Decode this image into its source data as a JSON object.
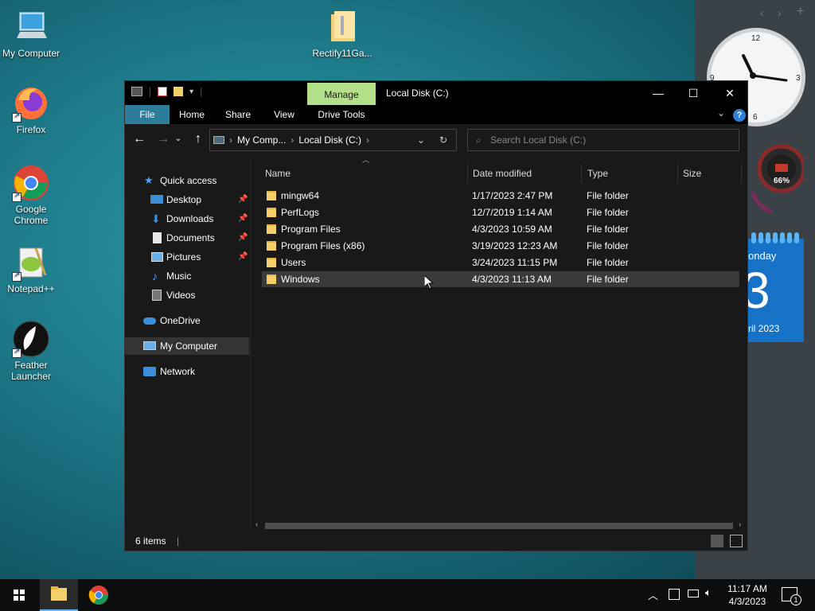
{
  "desktop": {
    "icons": [
      {
        "label": "My Computer",
        "icon": "computer-icon"
      },
      {
        "label": "Firefox",
        "icon": "firefox-icon"
      },
      {
        "label": "Google Chrome",
        "icon": "chrome-icon"
      },
      {
        "label": "Notepad++",
        "icon": "notepadpp-icon"
      },
      {
        "label": "Feather Launcher",
        "icon": "feather-icon"
      },
      {
        "label": "Rectify11Ga...",
        "icon": "zip-folder-icon"
      }
    ]
  },
  "widgets": {
    "clock": {
      "numbers": [
        "12",
        "3",
        "6",
        "9"
      ]
    },
    "gauge": {
      "value": "66%"
    },
    "calendar": {
      "day_name": "onday",
      "day": "3",
      "month_year": "ril 2023"
    }
  },
  "window": {
    "title": "Local Disk (C:)",
    "manage_tab": "Manage",
    "ribbon_tabs": [
      "File",
      "Home",
      "Share",
      "View"
    ],
    "drive_tools": "Drive Tools",
    "help": "?",
    "breadcrumb": [
      "My Comp...",
      "Local Disk (C:)"
    ],
    "search_placeholder": "Search Local Disk (C:)",
    "nav_pane": [
      {
        "label": "Quick access",
        "icon": "star-icon",
        "pinned": false
      },
      {
        "label": "Desktop",
        "icon": "desktop-icon",
        "pinned": true
      },
      {
        "label": "Downloads",
        "icon": "download-icon",
        "pinned": true
      },
      {
        "label": "Documents",
        "icon": "document-icon",
        "pinned": true
      },
      {
        "label": "Pictures",
        "icon": "picture-icon",
        "pinned": true
      },
      {
        "label": "Music",
        "icon": "music-icon",
        "pinned": false
      },
      {
        "label": "Videos",
        "icon": "video-icon",
        "pinned": false
      },
      {
        "label": "OneDrive",
        "icon": "cloud-icon",
        "pinned": false
      },
      {
        "label": "My Computer",
        "icon": "computer-icon",
        "pinned": false
      },
      {
        "label": "Network",
        "icon": "network-icon",
        "pinned": false
      }
    ],
    "columns": [
      "Name",
      "Date modified",
      "Type",
      "Size"
    ],
    "rows": [
      {
        "name": "mingw64",
        "date": "1/17/2023 2:47 PM",
        "type": "File folder"
      },
      {
        "name": "PerfLogs",
        "date": "12/7/2019 1:14 AM",
        "type": "File folder"
      },
      {
        "name": "Program Files",
        "date": "4/3/2023 10:59 AM",
        "type": "File folder"
      },
      {
        "name": "Program Files (x86)",
        "date": "3/19/2023 12:23 AM",
        "type": "File folder"
      },
      {
        "name": "Users",
        "date": "3/24/2023 11:15 PM",
        "type": "File folder"
      },
      {
        "name": "Windows",
        "date": "4/3/2023 11:13 AM",
        "type": "File folder"
      }
    ],
    "status": "6 items"
  },
  "taskbar": {
    "time": "11:17 AM",
    "date": "4/3/2023",
    "notifications": "1"
  },
  "colors": {
    "accent_file_tab": "#2d7d9a",
    "manage_tab": "#b5e08a",
    "folder": "#f5d06a"
  }
}
